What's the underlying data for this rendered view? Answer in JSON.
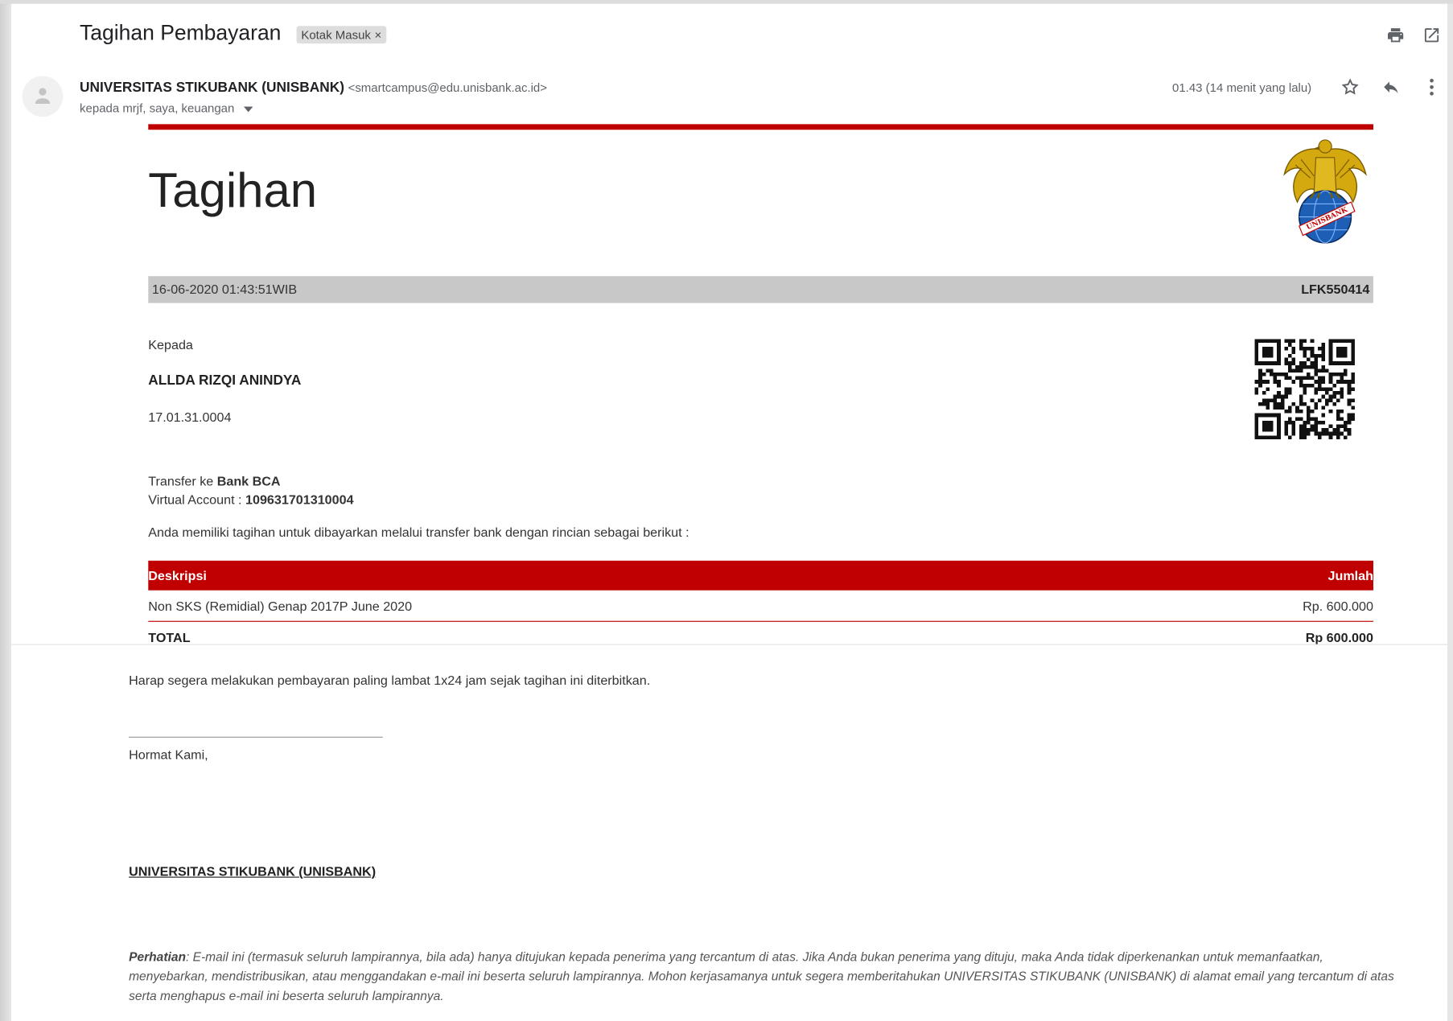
{
  "header": {
    "subject": "Tagihan Pembayaran",
    "label": "Kotak Masuk",
    "label_close": "×"
  },
  "message": {
    "sender_name": "UNIVERSITAS STIKUBANK (UNISBANK)",
    "sender_email": "<smartcampus@edu.unisbank.ac.id>",
    "recipients": "kepada mrjf, saya, keuangan",
    "time": "01.43 (14 menit yang lalu)"
  },
  "invoice": {
    "title": "Tagihan",
    "logo_text": "UNISBANK",
    "datetime": "16-06-2020 01:43:51WIB",
    "code": "LFK550414",
    "to_label": "Kepada",
    "name": "ALLDA RIZQI ANINDYA",
    "student_id": "17.01.31.0004",
    "transfer_prefix": "Transfer ke ",
    "bank": "Bank BCA",
    "va_prefix": "Virtual Account : ",
    "va_number": "109631701310004",
    "intro": "Anda memiliki tagihan untuk dibayarkan melalui transfer bank dengan rincian sebagai berikut :",
    "table": {
      "col_desc": "Deskripsi",
      "col_amount": "Jumlah",
      "rows": [
        {
          "desc": "Non SKS (Remidial) Genap 2017P June 2020",
          "amount": "Rp. 600.000"
        }
      ],
      "total_label": "TOTAL",
      "total_value": "Rp 600.000"
    }
  },
  "footer": {
    "notice": "Harap segera melakukan pembayaran paling lambat 1x24 jam sejak tagihan ini diterbitkan.",
    "regards": "Hormat Kami,",
    "org": "UNIVERSITAS STIKUBANK (UNISBANK)",
    "disclaimer_label": "Perhatian",
    "disclaimer_text": ": E-mail ini (termasuk seluruh lampirannya, bila ada) hanya ditujukan kepada penerima yang tercantum di atas. Jika Anda bukan penerima yang dituju, maka Anda tidak diperkenankan untuk memanfaatkan, menyebarkan, mendistribusikan, atau menggandakan e-mail ini beserta seluruh lampirannya. Mohon kerjasamanya untuk segera memberitahukan UNIVERSITAS STIKUBANK (UNISBANK) di alamat email yang tercantum di atas serta menghapus e-mail ini beserta seluruh lampirannya."
  },
  "colors": {
    "accent_red": "#c00000",
    "bar_grey": "#c8c8c8"
  }
}
